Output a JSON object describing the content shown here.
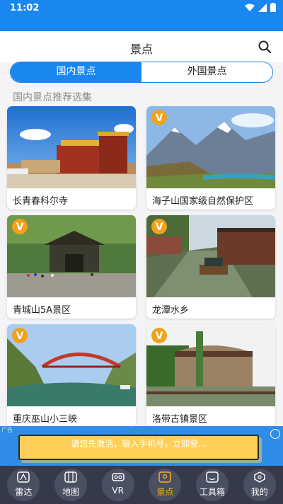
{
  "status_bar": {
    "time": "11:02"
  },
  "header": {
    "title": "景点"
  },
  "tabs": [
    {
      "label": "国内景点",
      "active": true
    },
    {
      "label": "外国景点",
      "active": false
    }
  ],
  "section_title": "国内景点推荐选集",
  "attractions": [
    {
      "name": "长青春科尔寺",
      "vip": false,
      "scene": "temple"
    },
    {
      "name": "海子山国家级自然保护区",
      "vip": true,
      "scene": "mountain"
    },
    {
      "name": "青城山5A景区",
      "vip": true,
      "scene": "gate"
    },
    {
      "name": "龙潭水乡",
      "vip": true,
      "scene": "canal"
    },
    {
      "name": "重庆巫山小三峡",
      "vip": true,
      "scene": "gorge"
    },
    {
      "name": "洛带古镇景区",
      "vip": true,
      "scene": "town"
    }
  ],
  "vip_badge_letter": "V",
  "ad": {
    "text": "请您先激活，输入手机号，立即登...",
    "tag": "广告"
  },
  "bottom_nav": [
    {
      "label": "雷达",
      "icon": "radar-icon"
    },
    {
      "label": "地图",
      "icon": "map-icon"
    },
    {
      "label": "VR",
      "icon": "vr-icon"
    },
    {
      "label": "景点",
      "icon": "scenic-icon",
      "active": true
    },
    {
      "label": "工具箱",
      "icon": "toolbox-icon"
    },
    {
      "label": "我的",
      "icon": "profile-icon"
    }
  ],
  "colors": {
    "primary": "#1a86f0",
    "nav_bg": "#35394a",
    "active_nav": "#ffb020"
  }
}
